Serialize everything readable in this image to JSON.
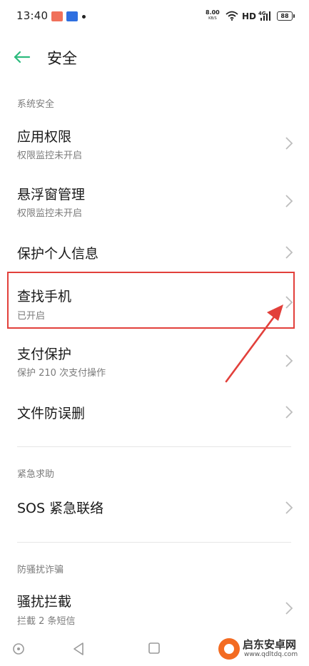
{
  "status_bar": {
    "time": "13:40",
    "net_speed_value": "8.00",
    "net_speed_unit": "KB/S",
    "network_type": "HD",
    "signal_label": "4G",
    "battery_level": "88",
    "icons": [
      "notification-app-icon",
      "notification-app-icon",
      "notification-dot",
      "wifi-icon",
      "signal-icon",
      "battery-icon"
    ]
  },
  "header": {
    "title": "安全",
    "back_icon": "back-arrow-icon"
  },
  "sections": [
    {
      "header": "系统安全",
      "items": [
        {
          "title": "应用权限",
          "subtitle": "权限监控未开启"
        },
        {
          "title": "悬浮窗管理",
          "subtitle": "权限监控未开启"
        },
        {
          "title": "保护个人信息",
          "subtitle": ""
        },
        {
          "title": "查找手机",
          "subtitle": "已开启"
        },
        {
          "title": "支付保护",
          "subtitle": "保护 210 次支付操作"
        },
        {
          "title": "文件防误删",
          "subtitle": ""
        }
      ]
    },
    {
      "header": "紧急求助",
      "items": [
        {
          "title": "SOS 紧急联络",
          "subtitle": ""
        }
      ]
    },
    {
      "header": "防骚扰诈骗",
      "items": [
        {
          "title": "骚扰拦截",
          "subtitle": "拦截 2 条短信"
        }
      ]
    }
  ],
  "annotation": {
    "color": "#e2403b",
    "highlighted_item": "查找手机"
  },
  "nav_bar": {
    "icons": [
      "circle-nav-icon",
      "back-triangle-icon",
      "home-square-icon"
    ]
  },
  "watermark": {
    "name": "启东安卓网",
    "url": "www.qdltdq.com"
  },
  "colors": {
    "accent": "#2dbb7e",
    "annotation": "#e2403b",
    "text_primary": "#1a1a1a",
    "text_secondary": "#7b7b7b"
  }
}
